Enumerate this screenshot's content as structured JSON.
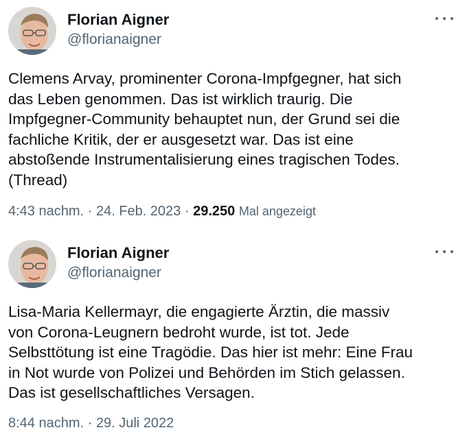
{
  "tweets": [
    {
      "author": {
        "name": "Florian Aigner",
        "handle": "@florianaigner"
      },
      "text_lines": [
        "Clemens Arvay, prominenter Corona-Impfgegner, hat sich",
        "das Leben genommen. Das ist wirklich traurig. Die",
        "Impfgegner-Community behauptet nun, der Grund sei die",
        "fachliche Kritik, der er ausgesetzt war. Das ist eine",
        "abstoßende Instrumentalisierung eines tragischen Todes.",
        "(Thread)"
      ],
      "time": "4:43 nachm.",
      "separator": "·",
      "date": "24. Feb. 2023",
      "views_count": "29.250",
      "views_label": "Mal angezeigt"
    },
    {
      "author": {
        "name": "Florian Aigner",
        "handle": "@florianaigner"
      },
      "text_lines": [
        "Lisa-Maria Kellermayr, die engagierte Ärztin, die massiv",
        "von Corona-Leugnern bedroht wurde, ist tot. Jede",
        "Selbsttötung ist eine Tragödie. Das hier ist mehr: Eine Frau",
        "in Not wurde von Polizei und Behörden im Stich gelassen.",
        "Das ist gesellschaftliches Versagen."
      ],
      "time": "8:44 nachm.",
      "separator": "·",
      "date": "29. Juli 2022"
    }
  ],
  "icons": {
    "more": "more-horizontal-icon",
    "avatar": "avatar-photo"
  },
  "colors": {
    "text": "#0f1419",
    "secondary": "#536471",
    "background": "#ffffff"
  }
}
